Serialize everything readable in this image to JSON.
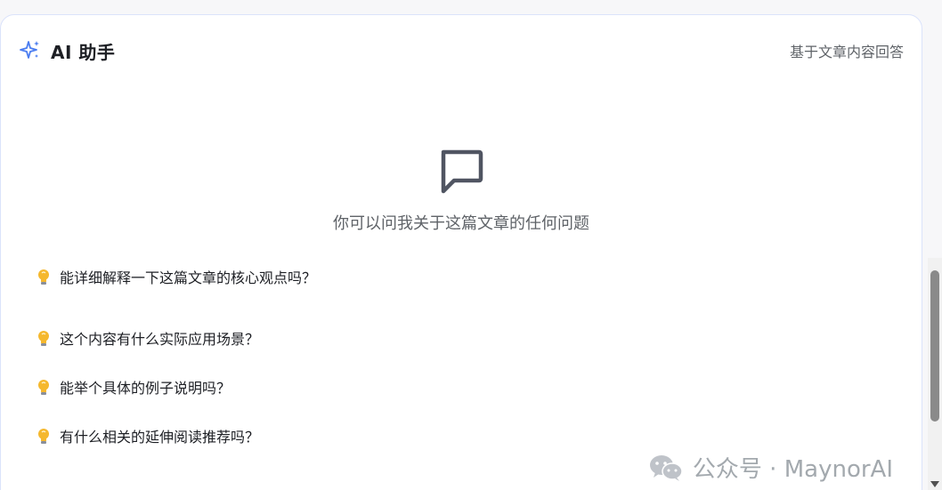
{
  "header": {
    "title": "AI 助手",
    "subtitle": "基于文章内容回答",
    "icon": "sparkle-icon"
  },
  "empty_state": {
    "icon": "chat-bubble-icon",
    "text": "你可以问我关于这篇文章的任何问题"
  },
  "suggestions": [
    {
      "icon": "lightbulb-icon",
      "text": "能详细解释一下这篇文章的核心观点吗？"
    },
    {
      "icon": "lightbulb-icon",
      "text": "这个内容有什么实际应用场景？"
    },
    {
      "icon": "lightbulb-icon",
      "text": "能举个具体的例子说明吗？"
    },
    {
      "icon": "lightbulb-icon",
      "text": "有什么相关的延伸阅读推荐吗？"
    }
  ],
  "watermark": {
    "icon": "wechat-icon",
    "text": "公众号 · MaynorAI"
  },
  "colors": {
    "accent": "#4a7cf0",
    "card_border": "#dbe3fb",
    "text_primary": "#1d1f24",
    "text_secondary": "#5f6368",
    "bulb": "#f5b82e"
  }
}
